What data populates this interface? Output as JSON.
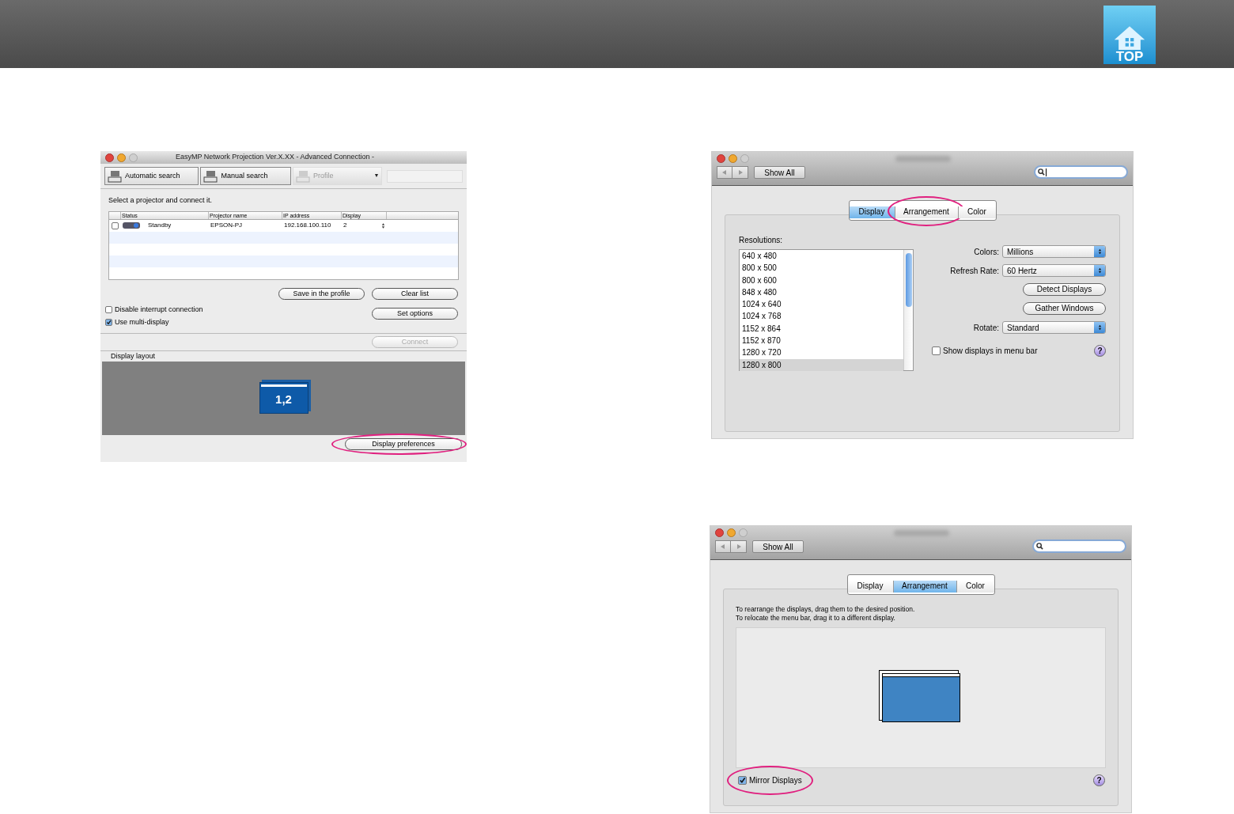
{
  "header": {
    "logo_label": "TOP"
  },
  "easymp_window": {
    "title": "EasyMP Network Projection Ver.X.XX - Advanced Connection -",
    "toolbar": [
      {
        "label": "Automatic search",
        "disabled": false,
        "has_menu": false
      },
      {
        "label": "Manual search",
        "disabled": false,
        "has_menu": false
      },
      {
        "label": "Profile",
        "disabled": true,
        "has_menu": true
      }
    ],
    "menu_caret": "▼",
    "prompt": "Select a projector and connect it.",
    "table": {
      "columns": [
        "Status",
        "Projector name",
        "IP address",
        "Display"
      ],
      "rows": [
        {
          "checked": false,
          "status": "Standby",
          "projector_name": "EPSON-PJ",
          "ip_address": "192.168.100.110",
          "display": "2"
        }
      ]
    },
    "list_buttons": [
      {
        "label": "Save in the profile",
        "disabled": false,
        "circled": false
      },
      {
        "label": "Clear list",
        "disabled": false,
        "circled": false
      }
    ],
    "options": [
      {
        "label": "Disable interrupt connection",
        "checked": false
      },
      {
        "label": "Use multi-display",
        "checked": true
      }
    ],
    "set_options": {
      "label": "Set options",
      "disabled": false,
      "circled": false
    },
    "connect": {
      "label": "Connect",
      "disabled": true,
      "circled": false
    },
    "layout_label": "Display layout",
    "layout_display": "1,2",
    "display_preferences": {
      "label": "Display preferences",
      "disabled": false,
      "circled": true
    }
  },
  "display_window": {
    "show_all": "Show All",
    "tabs": [
      {
        "label": "Display",
        "selected": true,
        "circled": false
      },
      {
        "label": "Arrangement",
        "selected": false,
        "circled": true
      },
      {
        "label": "Color",
        "selected": false,
        "circled": false
      }
    ],
    "resolutions_label": "Resolutions:",
    "resolutions": [
      {
        "label": "640 x 480",
        "selected": false
      },
      {
        "label": "800 x 500",
        "selected": false
      },
      {
        "label": "800 x 600",
        "selected": false
      },
      {
        "label": "848 x 480",
        "selected": false
      },
      {
        "label": "1024 x 640",
        "selected": false
      },
      {
        "label": "1024 x 768",
        "selected": false
      },
      {
        "label": "1152 x 864",
        "selected": false
      },
      {
        "label": "1152 x 870",
        "selected": false
      },
      {
        "label": "1280 x 720",
        "selected": false
      },
      {
        "label": "1280 x 800",
        "selected": true
      }
    ],
    "popups": [
      {
        "label": "Colors:",
        "value": "Millions"
      },
      {
        "label": "Refresh Rate:",
        "value": "60 Hertz"
      }
    ],
    "buttons": [
      "Detect Displays",
      "Gather Windows"
    ],
    "rotate": {
      "label": "Rotate:",
      "value": "Standard"
    },
    "menu_bar_option": {
      "label": "Show displays in menu bar",
      "checked": false
    },
    "help": "?"
  },
  "arrangement_window": {
    "show_all": "Show All",
    "tabs": [
      {
        "label": "Display",
        "selected": false,
        "circled": false
      },
      {
        "label": "Arrangement",
        "selected": true,
        "circled": false
      },
      {
        "label": "Color",
        "selected": false,
        "circled": false
      }
    ],
    "instructions": [
      "To rearrange the displays, drag them to the desired position.",
      "To relocate the menu bar, drag it to a different display."
    ],
    "mirror": {
      "label": "Mirror Displays",
      "checked": true,
      "circled": true
    },
    "help": "?"
  }
}
